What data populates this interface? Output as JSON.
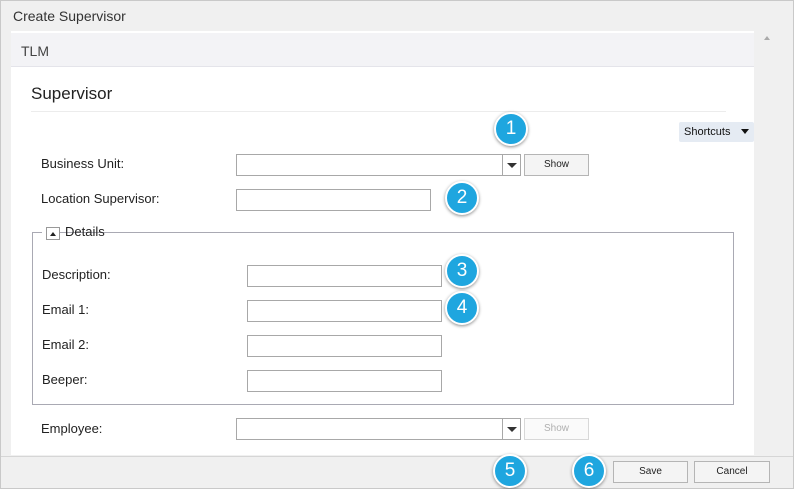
{
  "window": {
    "title": "Create Supervisor"
  },
  "app": {
    "module": "TLM"
  },
  "section": {
    "title": "Supervisor"
  },
  "shortcuts": {
    "label": "Shortcuts"
  },
  "form": {
    "business_unit": {
      "label": "Business Unit:",
      "value": "",
      "show_label": "Show"
    },
    "location_supervisor": {
      "label": "Location Supervisor:",
      "value": ""
    },
    "details": {
      "legend": "Details",
      "description": {
        "label": "Description:",
        "value": ""
      },
      "email1": {
        "label": "Email 1:",
        "value": ""
      },
      "email2": {
        "label": "Email 2:",
        "value": ""
      },
      "beeper": {
        "label": "Beeper:",
        "value": ""
      }
    },
    "employee": {
      "label": "Employee:",
      "value": "",
      "show_label": "Show"
    }
  },
  "footer": {
    "save_label": "Save",
    "cancel_label": "Cancel"
  },
  "callouts": [
    "1",
    "2",
    "3",
    "4",
    "5",
    "6"
  ],
  "colors": {
    "callout": "#1fa6df",
    "shortcuts_bg": "#e5ebf3",
    "header_bg": "#f3f3f6"
  }
}
